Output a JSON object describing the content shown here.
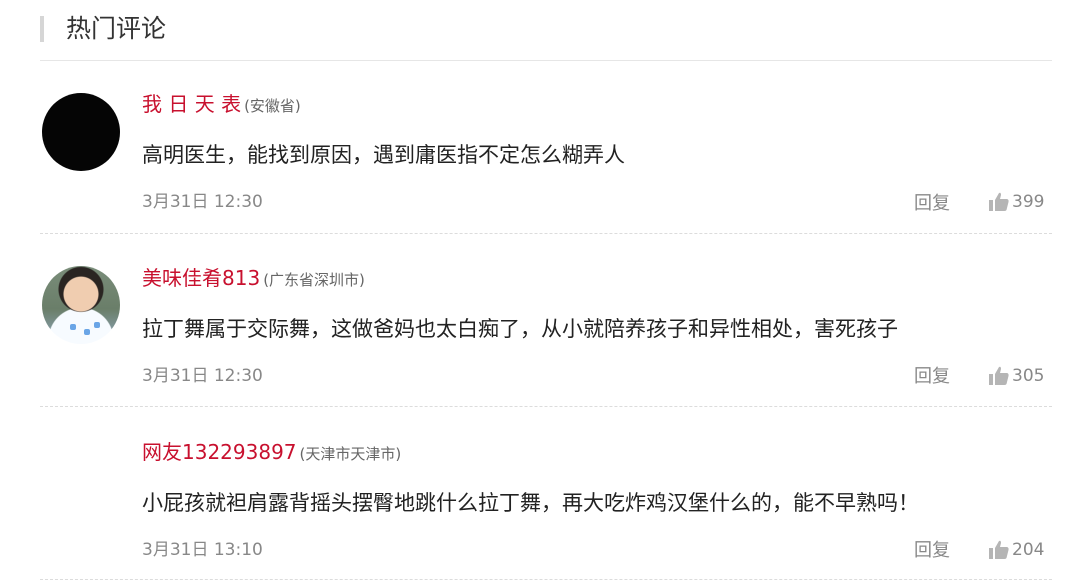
{
  "header": {
    "title": "热门评论"
  },
  "comments": [
    {
      "username": "我 日 天 表",
      "location": "(安徽省)",
      "text": "高明医生，能找到原因，遇到庸医指不定怎么糊弄人",
      "time": "3月31日 12:30",
      "reply_label": "回复",
      "likes": "399"
    },
    {
      "username": "美味佳肴813",
      "location": "(广东省深圳市)",
      "text": "拉丁舞属于交际舞，这做爸妈也太白痴了，从小就陪养孩子和异性相处，害死孩子",
      "time": "3月31日 12:30",
      "reply_label": "回复",
      "likes": "305"
    },
    {
      "username": "网友132293897",
      "location": "(天津市天津市)",
      "text": "小屁孩就袒肩露背摇头摆臀地跳什么拉丁舞，再大吃炸鸡汉堡什么的，能不早熟吗！",
      "time": "3月31日 13:10",
      "reply_label": "回复",
      "likes": "204"
    }
  ],
  "colors": {
    "username": "#c8102e",
    "meta": "#888888",
    "text": "#222222"
  },
  "icons": {
    "like": "thumbs-up-icon"
  }
}
